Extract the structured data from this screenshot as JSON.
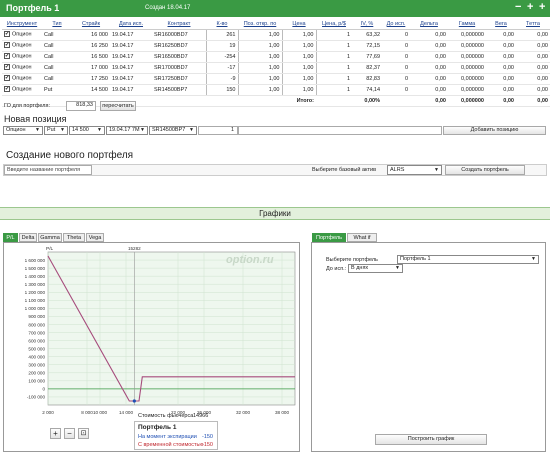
{
  "header": {
    "title": "Портфель 1",
    "created": "Создан 18.04.17",
    "minimize": "−",
    "maximize": "+",
    "add": "+"
  },
  "table": {
    "columns": [
      "Инструмент",
      "Тип",
      "Страйк",
      "Дата исп.",
      "Контракт",
      "К-во",
      "Поз. откр. по",
      "Цена",
      "Цена, р/$",
      "IV, %",
      "До исп.",
      "Дельта",
      "Гамма",
      "Вега",
      "Тетта",
      "+/-"
    ],
    "rows": [
      {
        "instrument": "Опцион",
        "type": "Call",
        "strike": "16 000",
        "date": "19.04.17",
        "contract": "SR16000BD7",
        "qty": "261",
        "open": "1,00",
        "price": "1,00",
        "price_rub": "1",
        "iv": "63,32",
        "days": "0",
        "delta": "0,00",
        "gamma": "0,000000",
        "vega": "0,00",
        "theta": "0,00"
      },
      {
        "instrument": "Опцион",
        "type": "Call",
        "strike": "16 250",
        "date": "19.04.17",
        "contract": "SR16250BD7",
        "qty": "19",
        "open": "1,00",
        "price": "1,00",
        "price_rub": "1",
        "iv": "72,15",
        "days": "0",
        "delta": "0,00",
        "gamma": "0,000000",
        "vega": "0,00",
        "theta": "0,00"
      },
      {
        "instrument": "Опцион",
        "type": "Call",
        "strike": "16 500",
        "date": "19.04.17",
        "contract": "SR16500BD7",
        "qty": "-254",
        "open": "1,00",
        "price": "1,00",
        "price_rub": "1",
        "iv": "77,69",
        "days": "0",
        "delta": "0,00",
        "gamma": "0,000000",
        "vega": "0,00",
        "theta": "0,00"
      },
      {
        "instrument": "Опцион",
        "type": "Call",
        "strike": "17 000",
        "date": "19.04.17",
        "contract": "SR17000BD7",
        "qty": "-17",
        "open": "1,00",
        "price": "1,00",
        "price_rub": "1",
        "iv": "82,37",
        "days": "0",
        "delta": "0,00",
        "gamma": "0,000000",
        "vega": "0,00",
        "theta": "0,00"
      },
      {
        "instrument": "Опцион",
        "type": "Call",
        "strike": "17 250",
        "date": "19.04.17",
        "contract": "SR17250BD7",
        "qty": "-9",
        "open": "1,00",
        "price": "1,00",
        "price_rub": "1",
        "iv": "82,83",
        "days": "0",
        "delta": "0,00",
        "gamma": "0,000000",
        "vega": "0,00",
        "theta": "0,00"
      },
      {
        "instrument": "Опцион",
        "type": "Put",
        "strike": "14 500",
        "date": "19.04.17",
        "contract": "SR14500BP7",
        "qty": "150",
        "open": "1,00",
        "price": "1,00",
        "price_rub": "1",
        "iv": "74,14",
        "days": "0",
        "delta": "0,00",
        "gamma": "0,000000",
        "vega": "0,00",
        "theta": "0,00"
      }
    ],
    "total_label": "Итого:",
    "total_pct": "0,00%",
    "total_delta": "0,00",
    "total_gamma": "0,000000",
    "total_vega": "0,00",
    "total_theta": "0,00"
  },
  "go": {
    "label": "ГО для портфеля:",
    "value": "818,33",
    "recalc_button": "пересчитать"
  },
  "new_position": {
    "heading": "Новая позиция",
    "instrument": "Опцион",
    "type": "Put",
    "strike": "14 500",
    "date": "19.04.17 7М",
    "contract": "SR14500BP7",
    "qty": "1",
    "add_button": "Добавить позицию"
  },
  "create_portfolio": {
    "heading": "Создание нового портфеля",
    "name_placeholder": "Введите название портфеля",
    "asset_label": "Выберите базовый актив",
    "asset_value": "ALRS",
    "create_button": "Создать портфель"
  },
  "graphs": {
    "heading": "Графики",
    "tabs": [
      "P/L",
      "Delta",
      "Gamma",
      "Theta",
      "Vega"
    ],
    "active_tab": "P/L",
    "watermark": "option.ru",
    "futures_label": "Стоимость фьючерса",
    "futures_value": "14966",
    "tooltip_title": "Портфель 1",
    "tooltip_expiry_label": "На момент экспирации",
    "tooltip_expiry_value": "-150",
    "tooltip_time_label": "С временной стоимостью",
    "tooltip_time_value": "-150",
    "zoom_in": "+",
    "zoom_out": "−",
    "zoom_reset": "⊡"
  },
  "right_panel": {
    "tabs": [
      "Портфель",
      "What if"
    ],
    "select_label": "Выберите портфель",
    "select_value": "Портфель 1",
    "days_label": "До исп.:",
    "days_value": "В днях",
    "build_button": "Построить график"
  },
  "chart_data": {
    "type": "line",
    "xlabel": "",
    "ylabel": "P/L",
    "xlim": [
      2000,
      40000
    ],
    "ylim": [
      -200,
      1700
    ],
    "x_ticks": [
      "2 000",
      "8 000",
      "10 000",
      "14 000",
      "22 000",
      "26 000",
      "32 000",
      "38 000"
    ],
    "y_ticks": [
      "1 600 000",
      "1 500 000",
      "1 400 000",
      "1 300 000",
      "1 200 000",
      "1 100 000",
      "1 000 000",
      "900 000",
      "800 000",
      "700 000",
      "600 000",
      "500 000",
      "400 000",
      "300 000",
      "200 000",
      "100 000",
      "0",
      "-100 000"
    ],
    "marker_x_label": "15282",
    "colors": {
      "line": "#a64c7c",
      "zero": "#3a9a44",
      "marker": "#999999"
    },
    "series": [
      {
        "values": [
          [
            2000,
            1650
          ],
          [
            14500,
            -150
          ],
          [
            15300,
            -150
          ],
          [
            16000,
            -150
          ],
          [
            16500,
            150
          ],
          [
            40000,
            150
          ]
        ]
      }
    ]
  }
}
